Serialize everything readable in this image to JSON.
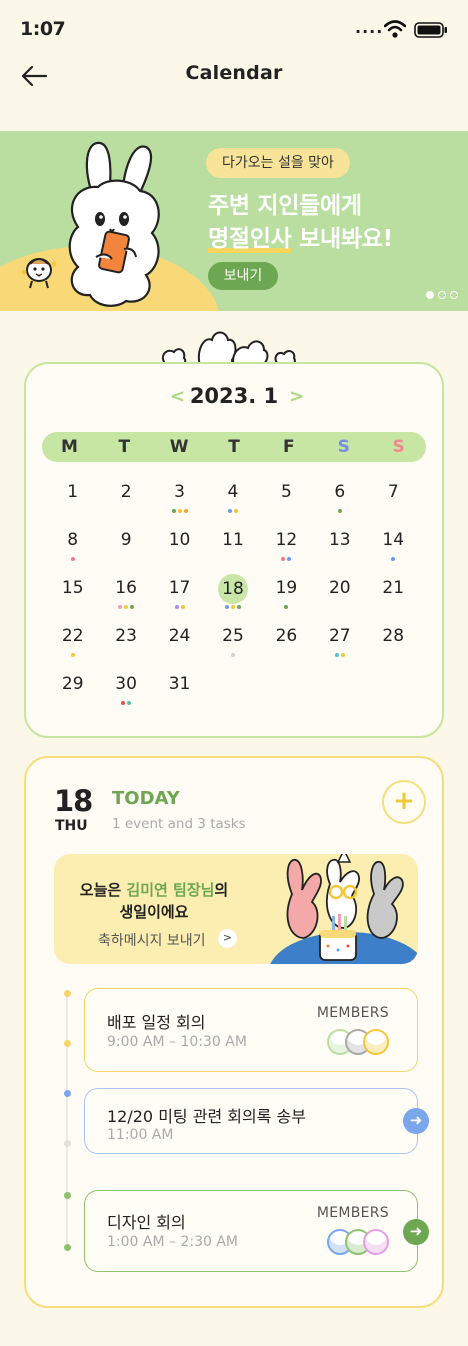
{
  "status": {
    "time": "1:07",
    "signal": "...."
  },
  "header": {
    "title": "Calendar",
    "back_icon": "back-arrow-icon"
  },
  "banner": {
    "tag": "다가오는 설을 맞아",
    "line1": "주변 지인들에게",
    "line2_highlight": "명절인사",
    "line2_rest": " 보내봐요!",
    "button": "보내기",
    "page_index": 1,
    "page_count": 3
  },
  "calendar": {
    "month_label": "2023. 1",
    "prev": "<",
    "next": ">",
    "weekdays": [
      "M",
      "T",
      "W",
      "T",
      "F",
      "S",
      "S"
    ],
    "weeks": [
      [
        {
          "d": "1",
          "dots": []
        },
        {
          "d": "2",
          "dots": []
        },
        {
          "d": "3",
          "dots": [
            "#6ea752",
            "#f2c83b",
            "#f2a53b"
          ]
        },
        {
          "d": "4",
          "dots": [
            "#6a9bf0",
            "#f2c83b"
          ]
        },
        {
          "d": "5",
          "dots": []
        },
        {
          "d": "6",
          "dots": [
            "#6ea752"
          ]
        },
        {
          "d": "7",
          "dots": []
        }
      ],
      [
        {
          "d": "8",
          "dots": [
            "#f07a9a"
          ]
        },
        {
          "d": "9",
          "dots": []
        },
        {
          "d": "10",
          "dots": []
        },
        {
          "d": "11",
          "dots": []
        },
        {
          "d": "12",
          "dots": [
            "#f07a7a",
            "#6a9bf0"
          ]
        },
        {
          "d": "13",
          "dots": []
        },
        {
          "d": "14",
          "dots": [
            "#6a9bf0"
          ]
        }
      ],
      [
        {
          "d": "15",
          "dots": []
        },
        {
          "d": "16",
          "dots": [
            "#f2a0b0",
            "#f2c83b",
            "#6ea752"
          ]
        },
        {
          "d": "17",
          "dots": [
            "#b58ae0",
            "#f2c83b"
          ]
        },
        {
          "d": "18",
          "dots": [
            "#6a9bf0",
            "#f2c83b",
            "#6ea752"
          ],
          "today": true
        },
        {
          "d": "19",
          "dots": [
            "#6ea752"
          ]
        },
        {
          "d": "20",
          "dots": []
        },
        {
          "d": "21",
          "dots": []
        }
      ],
      [
        {
          "d": "22",
          "dots": [
            "#f2c83b"
          ]
        },
        {
          "d": "23",
          "dots": []
        },
        {
          "d": "24",
          "dots": []
        },
        {
          "d": "25",
          "dots": [
            "#cfcfcf"
          ]
        },
        {
          "d": "26",
          "dots": []
        },
        {
          "d": "27",
          "dots": [
            "#5cc0c8",
            "#f2c83b"
          ]
        },
        {
          "d": "28",
          "dots": []
        }
      ],
      [
        {
          "d": "29",
          "dots": []
        },
        {
          "d": "30",
          "dots": [
            "#e05050",
            "#5cc0a0"
          ]
        },
        {
          "d": "31",
          "dots": []
        },
        {
          "d": "",
          "dots": []
        },
        {
          "d": "",
          "dots": []
        },
        {
          "d": "",
          "dots": []
        },
        {
          "d": "",
          "dots": []
        }
      ]
    ],
    "colors": {
      "saturday": "#7a8ce8",
      "sunday": "#f08a8a",
      "accent": "#c8e6a3"
    }
  },
  "schedule": {
    "day": "18",
    "weekday": "THU",
    "today_label": "TODAY",
    "summary": "1 event and 3 tasks",
    "add": "+",
    "birthday": {
      "prefix": "오늘은 ",
      "name": "김미연 팀장님",
      "suffix": "의",
      "line2": "생일이에요",
      "action": "축하메시지 보내기",
      "action_arrow": ">"
    },
    "events": [
      {
        "title": "배포 일정 회의",
        "time": "9:00 AM – 10:30 AM",
        "members_label": "MEMBERS",
        "color": "#f5d46a",
        "avatars": [
          "#b9dea0",
          "#aaaaaa",
          "#f2c83b"
        ],
        "arrow": false
      },
      {
        "title": "12/20 미팅 관련 회의록 송부",
        "time": "11:00 AM",
        "members_label": "",
        "color": "#a9c6ee",
        "avatars": [],
        "arrow": true,
        "arrow_color": "#7aa6ec"
      },
      {
        "title": "디자인 회의",
        "time": "1:00 AM – 2:30 AM",
        "members_label": "MEMBERS",
        "color": "#8fc26f",
        "avatars": [
          "#7aa6ec",
          "#8fc26f",
          "#e0a0e0"
        ],
        "arrow": true,
        "arrow_color": "#6ea752"
      }
    ]
  }
}
